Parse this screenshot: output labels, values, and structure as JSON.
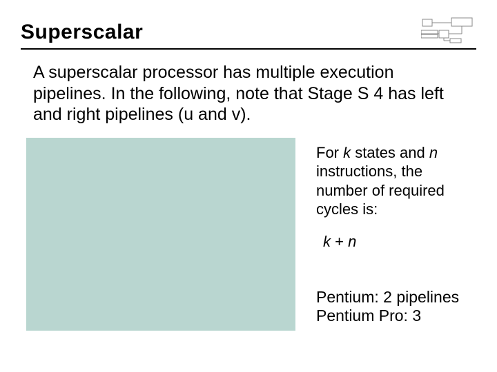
{
  "title": "Superscalar",
  "intro": "A superscalar processor has multiple execution pipelines. In the following, note that Stage S 4 has left and right pipelines (u and v).",
  "desc_pre": "For ",
  "desc_var1": "k",
  "desc_mid1": " states and ",
  "desc_var2": "n",
  "desc_mid2": " instructions, the number of required cycles is:",
  "formula_k": "k",
  "formula_plus": " + ",
  "formula_n": "n",
  "pentium_line1": "Pentium: 2 pipelines",
  "pentium_line2": "Pentium Pro: 3"
}
